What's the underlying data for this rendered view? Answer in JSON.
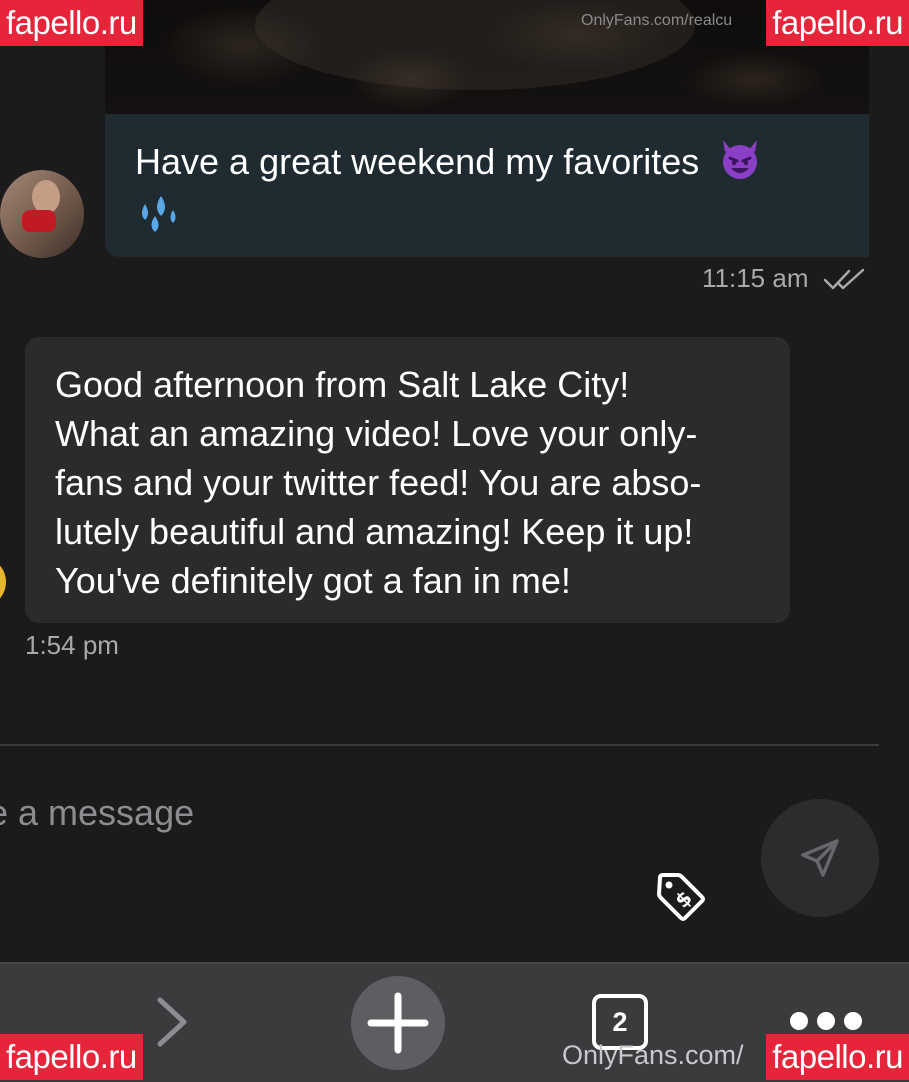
{
  "watermark_badges": {
    "top_left": "fapello.ru",
    "top_right": "fapello.ru",
    "bottom_left": "fapello.ru",
    "bottom_right": "fapello.ru"
  },
  "media_preview": {
    "watermark": "OnlyFans.com/realcu"
  },
  "messages": [
    {
      "direction": "outgoing",
      "text": "Have a great weekend my favorites",
      "emojis": [
        "smiling-devil-emoji",
        "sweat-droplets-emoji"
      ],
      "time": "11:15 am",
      "status_icon": "double-check-icon"
    },
    {
      "direction": "incoming",
      "text": "Good afternoon from Salt Lake City!\nWhat an amazing video! Love your only-\nfans and your twitter feed! You are abso-\nlutely beautiful and amazing! Keep it up!\nYou've definitely got a fan in me!",
      "time": "1:54 pm"
    }
  ],
  "composer": {
    "placeholder": "e a message",
    "price_icon": "price-tag-icon",
    "send_icon": "send-icon"
  },
  "browser_toolbar": {
    "forward_icon": "chevron-right-icon",
    "new_tab_icon": "plus-icon",
    "tab_count": "2",
    "menu_icon": "more-dots-icon",
    "url_watermark": "OnlyFans.com/"
  },
  "colors": {
    "background": "#1b1b1c",
    "outgoing_bubble": "#1f2a31",
    "incoming_bubble": "#2a2b2d",
    "badge": "#e6253a",
    "toolbar": "#3b3b3e"
  }
}
